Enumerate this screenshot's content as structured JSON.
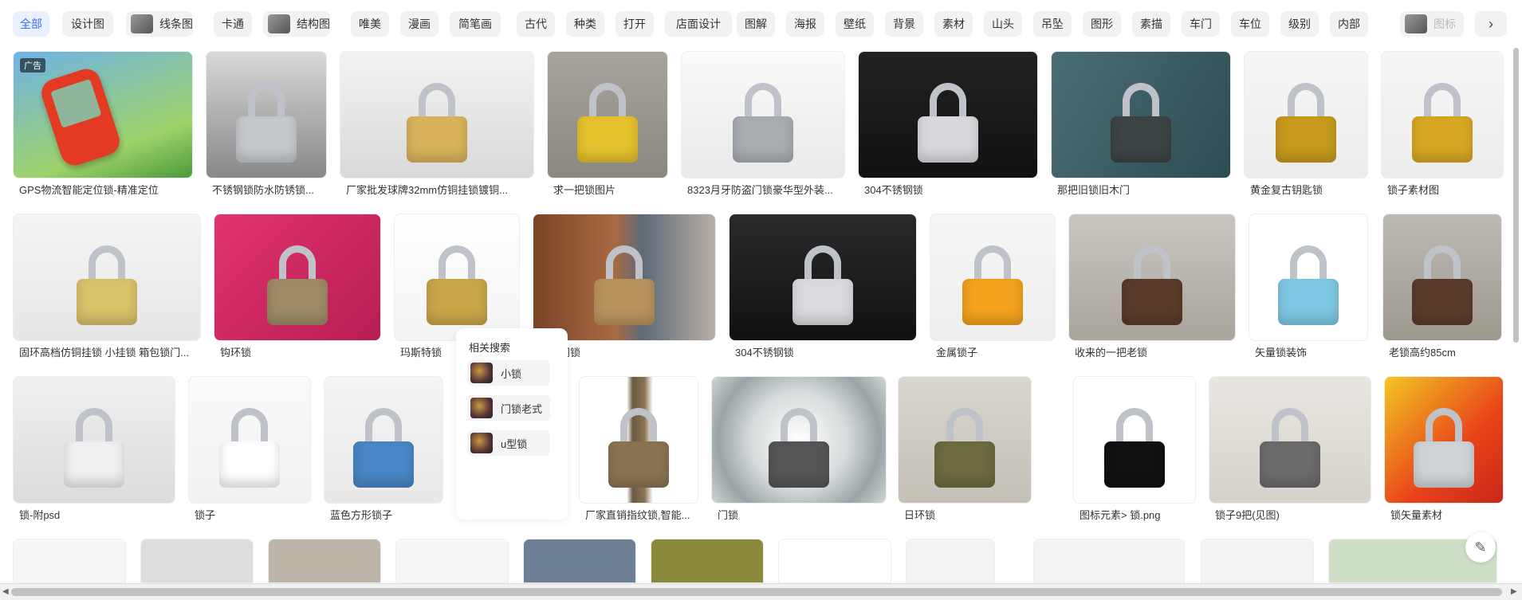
{
  "filters": [
    {
      "label": "全部",
      "active": true
    },
    {
      "label": "设计图"
    },
    {
      "label": "线条图",
      "thumb": true
    },
    {
      "label": "卡通"
    },
    {
      "label": "结构图",
      "thumb": true
    },
    {
      "label": "唯美"
    },
    {
      "label": "漫画"
    },
    {
      "label": "简笔画"
    },
    {
      "label": "古代"
    },
    {
      "label": "种类"
    },
    {
      "label": "打开"
    },
    {
      "label": "店面设计"
    },
    {
      "label": "图解"
    },
    {
      "label": "海报"
    },
    {
      "label": "壁纸"
    },
    {
      "label": "背景"
    },
    {
      "label": "素材"
    },
    {
      "label": "山头"
    },
    {
      "label": "吊坠"
    },
    {
      "label": "图形"
    },
    {
      "label": "素描"
    },
    {
      "label": "车门"
    },
    {
      "label": "车位"
    },
    {
      "label": "级别"
    },
    {
      "label": "内部"
    },
    {
      "label": "图标",
      "thumb": true,
      "faded": true
    }
  ],
  "next_icon": "chevron-right-icon",
  "ad_badge": "广告",
  "row1": [
    "GPS物流智能定位锁-精准定位",
    "不锈钢锁防水防锈锁...",
    "厂家批发球牌32mm仿铜挂锁镀铜...",
    "求一把锁图片",
    "8323月牙防盗门锁豪华型外装...",
    "304不锈钢锁",
    "那把旧锁旧木门",
    "黄金复古钥匙锁",
    "锁子素材图"
  ],
  "row2": [
    "固环高档仿铜挂锁 小挂锁 箱包锁门...",
    "钩环锁",
    "玛斯特锁",
    "室内门锁",
    "304不锈钢锁",
    "金属锁子",
    "收来的一把老锁",
    "矢量锁装饰",
    "老锁高约85cm"
  ],
  "row3": [
    "锁-附psd",
    "锁子",
    "蓝色方形锁子",
    "厂家直销指纹锁,智能...",
    "门锁",
    "日环锁",
    "图标元素> 锁.png",
    "锁子9把(见图)",
    "锁矢量素材"
  ],
  "related": {
    "title": "相关搜索",
    "items": [
      "小锁",
      "门锁老式",
      "u型锁"
    ]
  },
  "colors": {
    "accent": "#3a6cf4",
    "chip_bg": "#f1f2f4"
  }
}
